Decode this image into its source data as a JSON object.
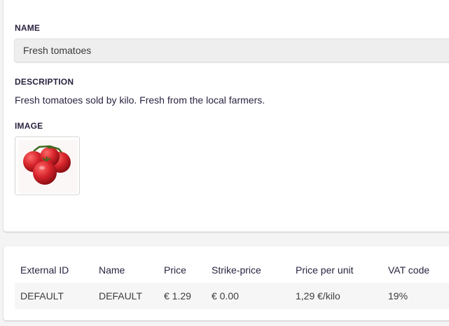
{
  "product": {
    "name_label": "NAME",
    "name_value": "Fresh tomatoes",
    "description_label": "DESCRIPTION",
    "description": "Fresh tomatoes sold by kilo. Fresh from the local farmers.",
    "image_label": "IMAGE",
    "image_icon": "tomato-image"
  },
  "variants": {
    "columns": [
      "External ID",
      "Name",
      "Price",
      "Strike-price",
      "Price per unit",
      "VAT code"
    ],
    "rows": [
      [
        "DEFAULT",
        "DEFAULT",
        "€ 1.29",
        "€ 0.00",
        "1,29 €/kilo",
        "19%"
      ]
    ]
  },
  "colors": {
    "text": "#2b2340",
    "input_bg": "#eeeeee",
    "row_bg": "#f6f6f6",
    "tomato": "#d6242b"
  }
}
